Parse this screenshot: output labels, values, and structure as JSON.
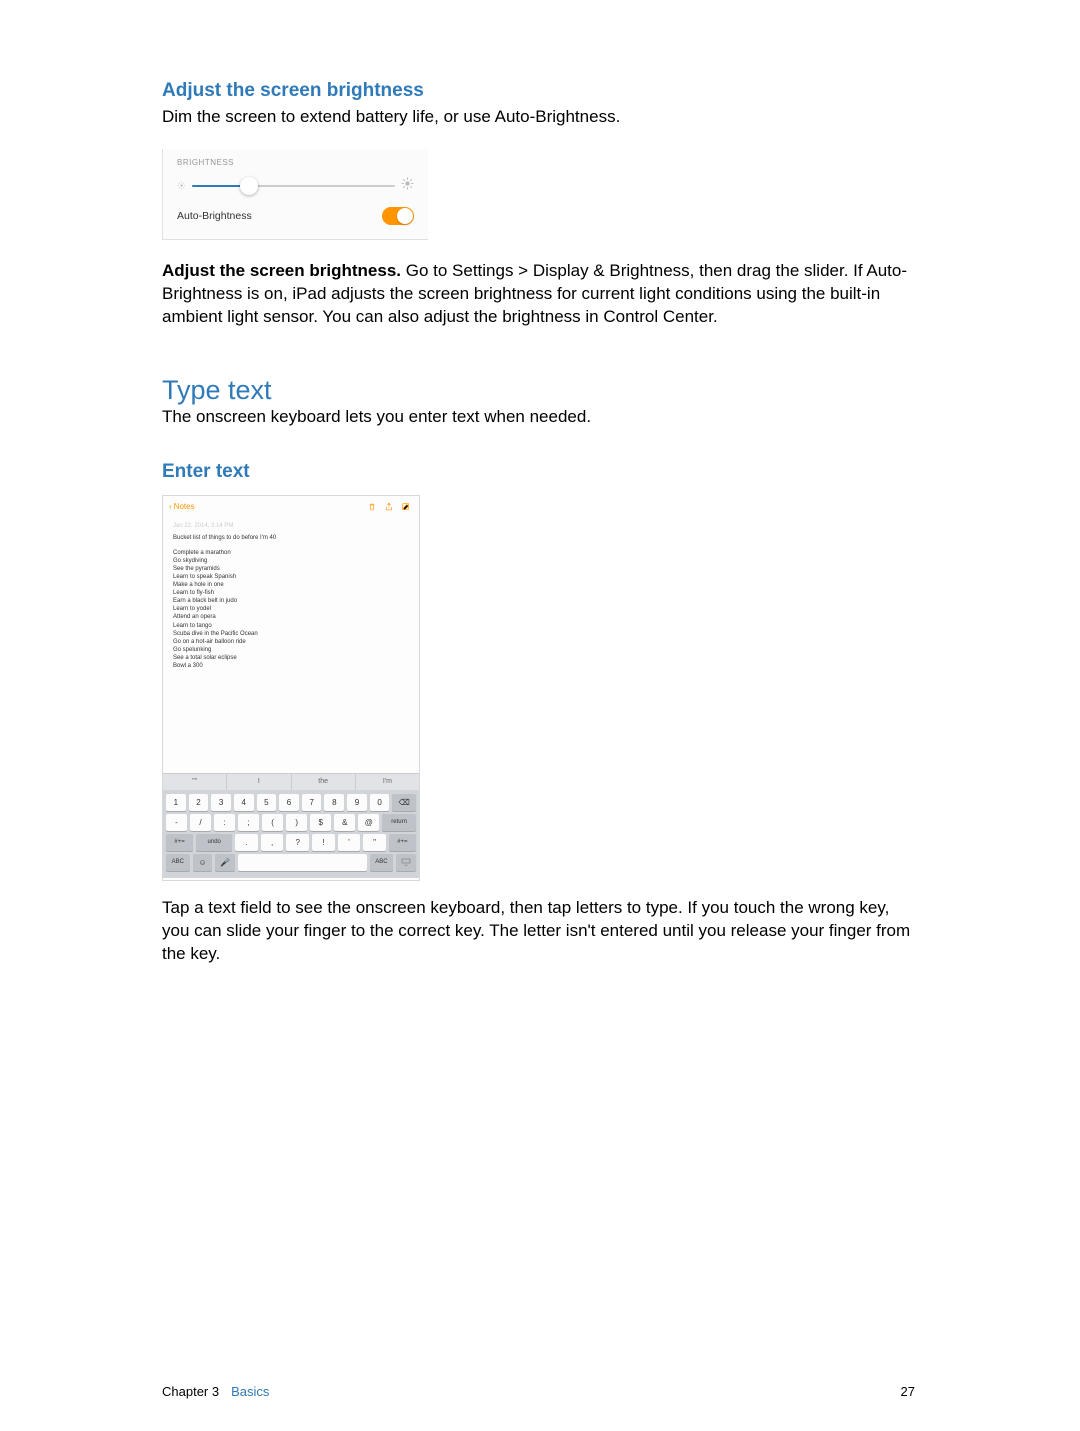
{
  "section_brightness": {
    "heading": "Adjust the screen brightness",
    "intro": "Dim the screen to extend battery life, or use Auto-Brightness.",
    "panel": {
      "label": "BRIGHTNESS",
      "auto_label": "Auto-Brightness"
    },
    "para_bold": "Adjust the screen brightness.",
    "para_rest": " Go to Settings > Display & Brightness, then drag the slider. If Auto-Brightness is on, iPad adjusts the screen brightness for current light conditions using the built-in ambient light sensor. You can also adjust the brightness in Control Center."
  },
  "section_type": {
    "heading": "Type text",
    "intro": "The onscreen keyboard lets you enter text when needed."
  },
  "section_enter": {
    "heading": "Enter text",
    "notes": {
      "back": "Notes",
      "timestamp": "Jan 22, 2014, 3:14 PM",
      "title": "Bucket list of things to do before I'm 40",
      "items": [
        "Complete a marathon",
        "Go skydiving",
        "See the pyramids",
        "Learn to speak Spanish",
        "Make a hole in one",
        "Learn to fly-fish",
        "Earn a black belt in judo",
        "Learn to yodel",
        "Attend an opera",
        "Learn to tango",
        "Scuba dive in the Pacific Ocean",
        "Go on a hot-air balloon ride",
        "Go spelunking",
        "See a total solar eclipse",
        "Bowl a 300"
      ],
      "suggestions": [
        "\"\"",
        "I",
        "the",
        "I'm"
      ],
      "keyboard": {
        "row1": [
          "1",
          "2",
          "3",
          "4",
          "5",
          "6",
          "7",
          "8",
          "9",
          "0"
        ],
        "row2": [
          "-",
          "/",
          ":",
          ";",
          "(",
          ")",
          "$",
          "&",
          "@"
        ],
        "row3": [
          ".",
          ",",
          "?",
          "!",
          "'",
          "\""
        ],
        "sym": "#+=",
        "undo": "undo",
        "return": "return",
        "abc": "ABC"
      }
    },
    "after": "Tap a text field to see the onscreen keyboard, then tap letters to type. If you touch the wrong key, you can slide your finger to the correct key. The letter isn't entered until you release your finger from the key."
  },
  "footer": {
    "chapter": "Chapter  3",
    "section": "Basics",
    "page": "27"
  }
}
